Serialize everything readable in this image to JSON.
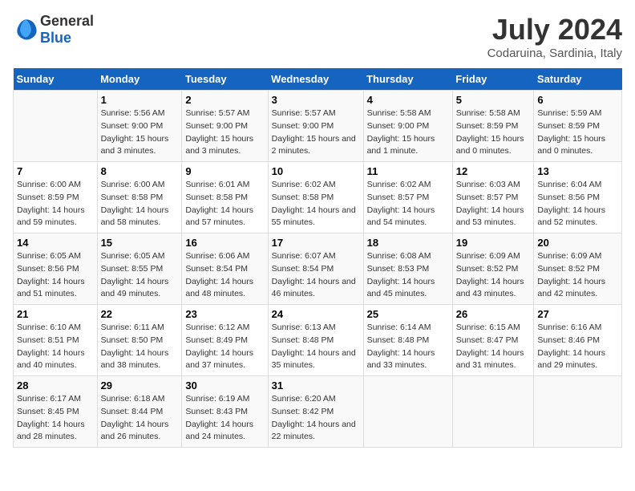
{
  "header": {
    "logo_general": "General",
    "logo_blue": "Blue",
    "title": "July 2024",
    "subtitle": "Codaruina, Sardinia, Italy"
  },
  "weekdays": [
    "Sunday",
    "Monday",
    "Tuesday",
    "Wednesday",
    "Thursday",
    "Friday",
    "Saturday"
  ],
  "weeks": [
    [
      {
        "day": "",
        "sunrise": "",
        "sunset": "",
        "daylight": ""
      },
      {
        "day": "1",
        "sunrise": "Sunrise: 5:56 AM",
        "sunset": "Sunset: 9:00 PM",
        "daylight": "Daylight: 15 hours and 3 minutes."
      },
      {
        "day": "2",
        "sunrise": "Sunrise: 5:57 AM",
        "sunset": "Sunset: 9:00 PM",
        "daylight": "Daylight: 15 hours and 3 minutes."
      },
      {
        "day": "3",
        "sunrise": "Sunrise: 5:57 AM",
        "sunset": "Sunset: 9:00 PM",
        "daylight": "Daylight: 15 hours and 2 minutes."
      },
      {
        "day": "4",
        "sunrise": "Sunrise: 5:58 AM",
        "sunset": "Sunset: 9:00 PM",
        "daylight": "Daylight: 15 hours and 1 minute."
      },
      {
        "day": "5",
        "sunrise": "Sunrise: 5:58 AM",
        "sunset": "Sunset: 8:59 PM",
        "daylight": "Daylight: 15 hours and 0 minutes."
      },
      {
        "day": "6",
        "sunrise": "Sunrise: 5:59 AM",
        "sunset": "Sunset: 8:59 PM",
        "daylight": "Daylight: 15 hours and 0 minutes."
      }
    ],
    [
      {
        "day": "7",
        "sunrise": "Sunrise: 6:00 AM",
        "sunset": "Sunset: 8:59 PM",
        "daylight": "Daylight: 14 hours and 59 minutes."
      },
      {
        "day": "8",
        "sunrise": "Sunrise: 6:00 AM",
        "sunset": "Sunset: 8:58 PM",
        "daylight": "Daylight: 14 hours and 58 minutes."
      },
      {
        "day": "9",
        "sunrise": "Sunrise: 6:01 AM",
        "sunset": "Sunset: 8:58 PM",
        "daylight": "Daylight: 14 hours and 57 minutes."
      },
      {
        "day": "10",
        "sunrise": "Sunrise: 6:02 AM",
        "sunset": "Sunset: 8:58 PM",
        "daylight": "Daylight: 14 hours and 55 minutes."
      },
      {
        "day": "11",
        "sunrise": "Sunrise: 6:02 AM",
        "sunset": "Sunset: 8:57 PM",
        "daylight": "Daylight: 14 hours and 54 minutes."
      },
      {
        "day": "12",
        "sunrise": "Sunrise: 6:03 AM",
        "sunset": "Sunset: 8:57 PM",
        "daylight": "Daylight: 14 hours and 53 minutes."
      },
      {
        "day": "13",
        "sunrise": "Sunrise: 6:04 AM",
        "sunset": "Sunset: 8:56 PM",
        "daylight": "Daylight: 14 hours and 52 minutes."
      }
    ],
    [
      {
        "day": "14",
        "sunrise": "Sunrise: 6:05 AM",
        "sunset": "Sunset: 8:56 PM",
        "daylight": "Daylight: 14 hours and 51 minutes."
      },
      {
        "day": "15",
        "sunrise": "Sunrise: 6:05 AM",
        "sunset": "Sunset: 8:55 PM",
        "daylight": "Daylight: 14 hours and 49 minutes."
      },
      {
        "day": "16",
        "sunrise": "Sunrise: 6:06 AM",
        "sunset": "Sunset: 8:54 PM",
        "daylight": "Daylight: 14 hours and 48 minutes."
      },
      {
        "day": "17",
        "sunrise": "Sunrise: 6:07 AM",
        "sunset": "Sunset: 8:54 PM",
        "daylight": "Daylight: 14 hours and 46 minutes."
      },
      {
        "day": "18",
        "sunrise": "Sunrise: 6:08 AM",
        "sunset": "Sunset: 8:53 PM",
        "daylight": "Daylight: 14 hours and 45 minutes."
      },
      {
        "day": "19",
        "sunrise": "Sunrise: 6:09 AM",
        "sunset": "Sunset: 8:52 PM",
        "daylight": "Daylight: 14 hours and 43 minutes."
      },
      {
        "day": "20",
        "sunrise": "Sunrise: 6:09 AM",
        "sunset": "Sunset: 8:52 PM",
        "daylight": "Daylight: 14 hours and 42 minutes."
      }
    ],
    [
      {
        "day": "21",
        "sunrise": "Sunrise: 6:10 AM",
        "sunset": "Sunset: 8:51 PM",
        "daylight": "Daylight: 14 hours and 40 minutes."
      },
      {
        "day": "22",
        "sunrise": "Sunrise: 6:11 AM",
        "sunset": "Sunset: 8:50 PM",
        "daylight": "Daylight: 14 hours and 38 minutes."
      },
      {
        "day": "23",
        "sunrise": "Sunrise: 6:12 AM",
        "sunset": "Sunset: 8:49 PM",
        "daylight": "Daylight: 14 hours and 37 minutes."
      },
      {
        "day": "24",
        "sunrise": "Sunrise: 6:13 AM",
        "sunset": "Sunset: 8:48 PM",
        "daylight": "Daylight: 14 hours and 35 minutes."
      },
      {
        "day": "25",
        "sunrise": "Sunrise: 6:14 AM",
        "sunset": "Sunset: 8:48 PM",
        "daylight": "Daylight: 14 hours and 33 minutes."
      },
      {
        "day": "26",
        "sunrise": "Sunrise: 6:15 AM",
        "sunset": "Sunset: 8:47 PM",
        "daylight": "Daylight: 14 hours and 31 minutes."
      },
      {
        "day": "27",
        "sunrise": "Sunrise: 6:16 AM",
        "sunset": "Sunset: 8:46 PM",
        "daylight": "Daylight: 14 hours and 29 minutes."
      }
    ],
    [
      {
        "day": "28",
        "sunrise": "Sunrise: 6:17 AM",
        "sunset": "Sunset: 8:45 PM",
        "daylight": "Daylight: 14 hours and 28 minutes."
      },
      {
        "day": "29",
        "sunrise": "Sunrise: 6:18 AM",
        "sunset": "Sunset: 8:44 PM",
        "daylight": "Daylight: 14 hours and 26 minutes."
      },
      {
        "day": "30",
        "sunrise": "Sunrise: 6:19 AM",
        "sunset": "Sunset: 8:43 PM",
        "daylight": "Daylight: 14 hours and 24 minutes."
      },
      {
        "day": "31",
        "sunrise": "Sunrise: 6:20 AM",
        "sunset": "Sunset: 8:42 PM",
        "daylight": "Daylight: 14 hours and 22 minutes."
      },
      {
        "day": "",
        "sunrise": "",
        "sunset": "",
        "daylight": ""
      },
      {
        "day": "",
        "sunrise": "",
        "sunset": "",
        "daylight": ""
      },
      {
        "day": "",
        "sunrise": "",
        "sunset": "",
        "daylight": ""
      }
    ]
  ]
}
